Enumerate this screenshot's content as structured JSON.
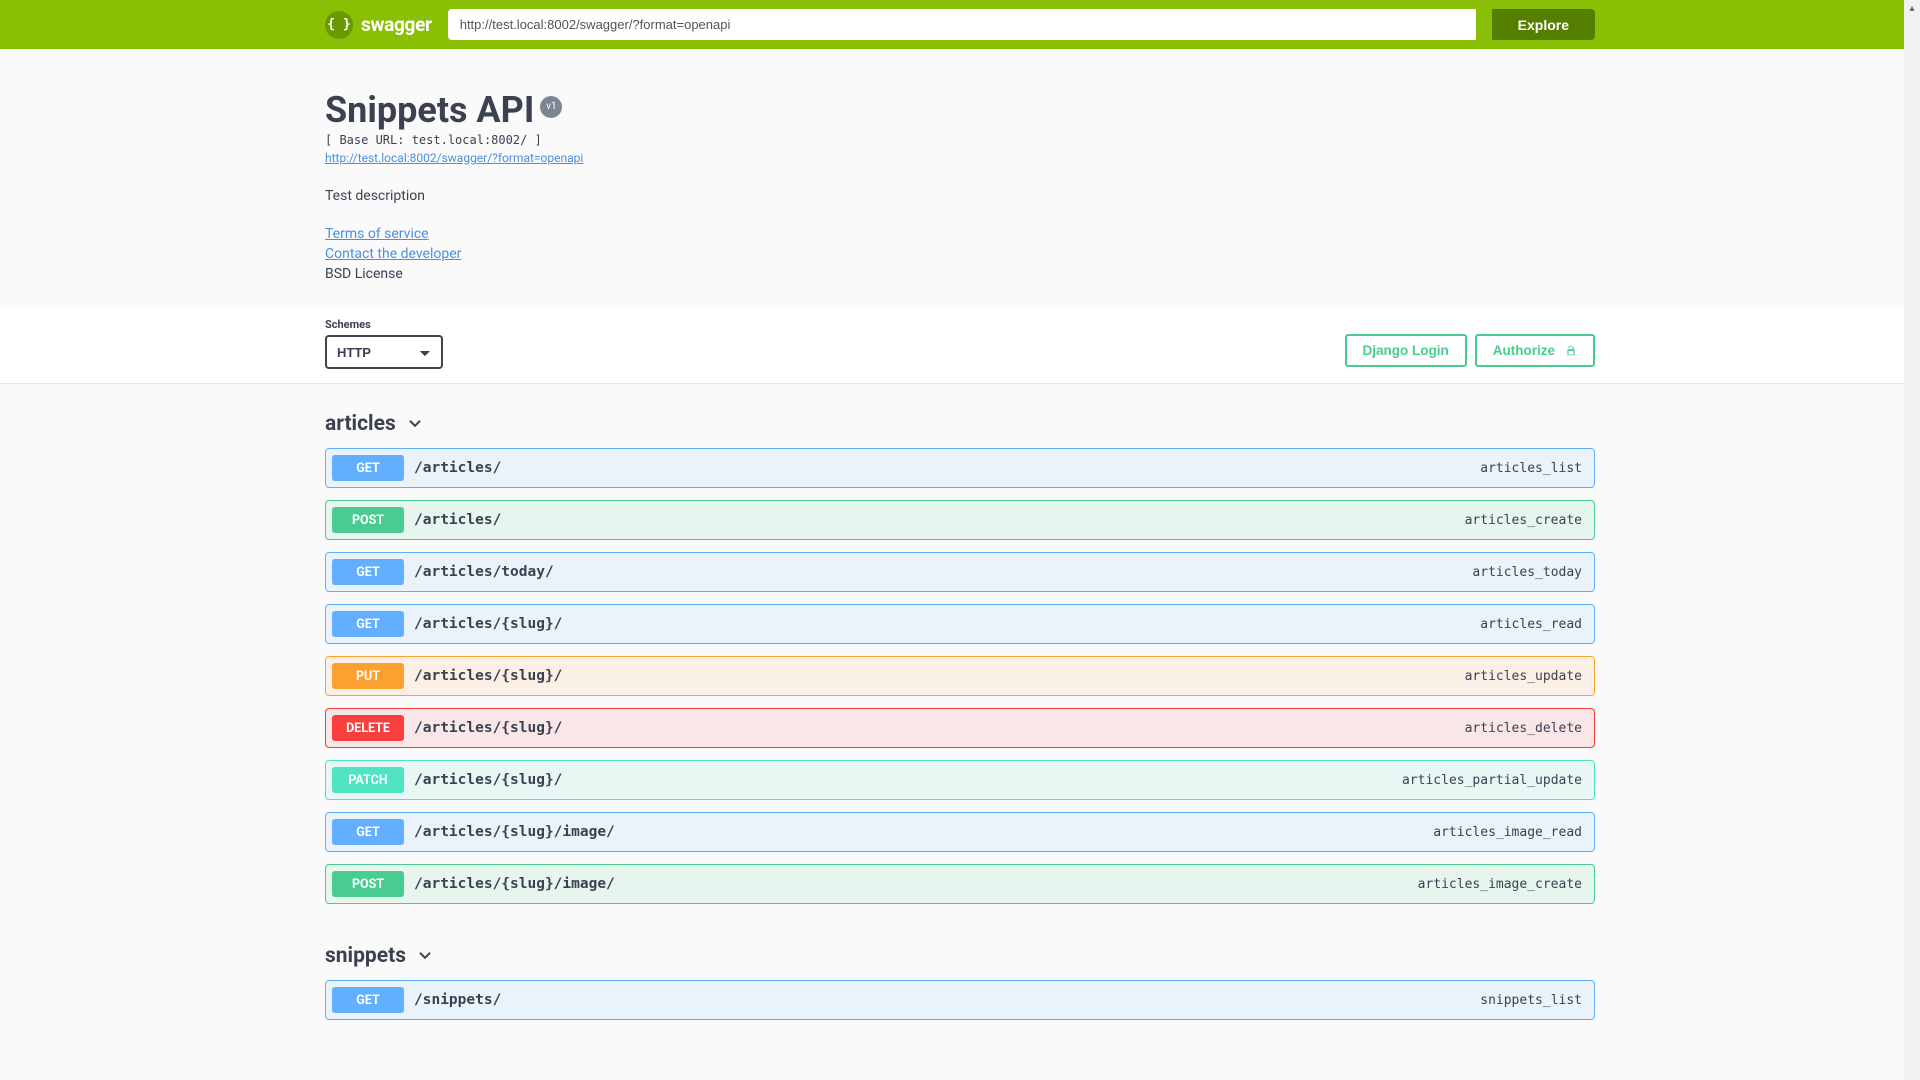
{
  "topbar": {
    "logo_text": "swagger",
    "url_value": "http://test.local:8002/swagger/?format=openapi",
    "explore_label": "Explore"
  },
  "info": {
    "title": "Snippets API",
    "version_badge": "v1",
    "base_url": "[ Base URL: test.local:8002/ ]",
    "spec_link": "http://test.local:8002/swagger/?format=openapi",
    "description": "Test description",
    "tos_label": "Terms of service",
    "contact_label": "Contact the developer",
    "license": "BSD License"
  },
  "schemes": {
    "label": "Schemes",
    "selected": "HTTP"
  },
  "auth": {
    "django_login_label": "Django Login",
    "authorize_label": "Authorize"
  },
  "tags": [
    {
      "name": "articles",
      "ops": [
        {
          "method": "GET",
          "css": "get",
          "path": "/articles/",
          "op_id": "articles_list"
        },
        {
          "method": "POST",
          "css": "post",
          "path": "/articles/",
          "op_id": "articles_create"
        },
        {
          "method": "GET",
          "css": "get",
          "path": "/articles/today/",
          "op_id": "articles_today"
        },
        {
          "method": "GET",
          "css": "get",
          "path": "/articles/{slug}/",
          "op_id": "articles_read"
        },
        {
          "method": "PUT",
          "css": "put",
          "path": "/articles/{slug}/",
          "op_id": "articles_update"
        },
        {
          "method": "DELETE",
          "css": "delete",
          "path": "/articles/{slug}/",
          "op_id": "articles_delete"
        },
        {
          "method": "PATCH",
          "css": "patch",
          "path": "/articles/{slug}/",
          "op_id": "articles_partial_update"
        },
        {
          "method": "GET",
          "css": "get",
          "path": "/articles/{slug}/image/",
          "op_id": "articles_image_read"
        },
        {
          "method": "POST",
          "css": "post",
          "path": "/articles/{slug}/image/",
          "op_id": "articles_image_create"
        }
      ]
    },
    {
      "name": "snippets",
      "ops": [
        {
          "method": "GET",
          "css": "get",
          "path": "/snippets/",
          "op_id": "snippets_list"
        }
      ]
    }
  ]
}
